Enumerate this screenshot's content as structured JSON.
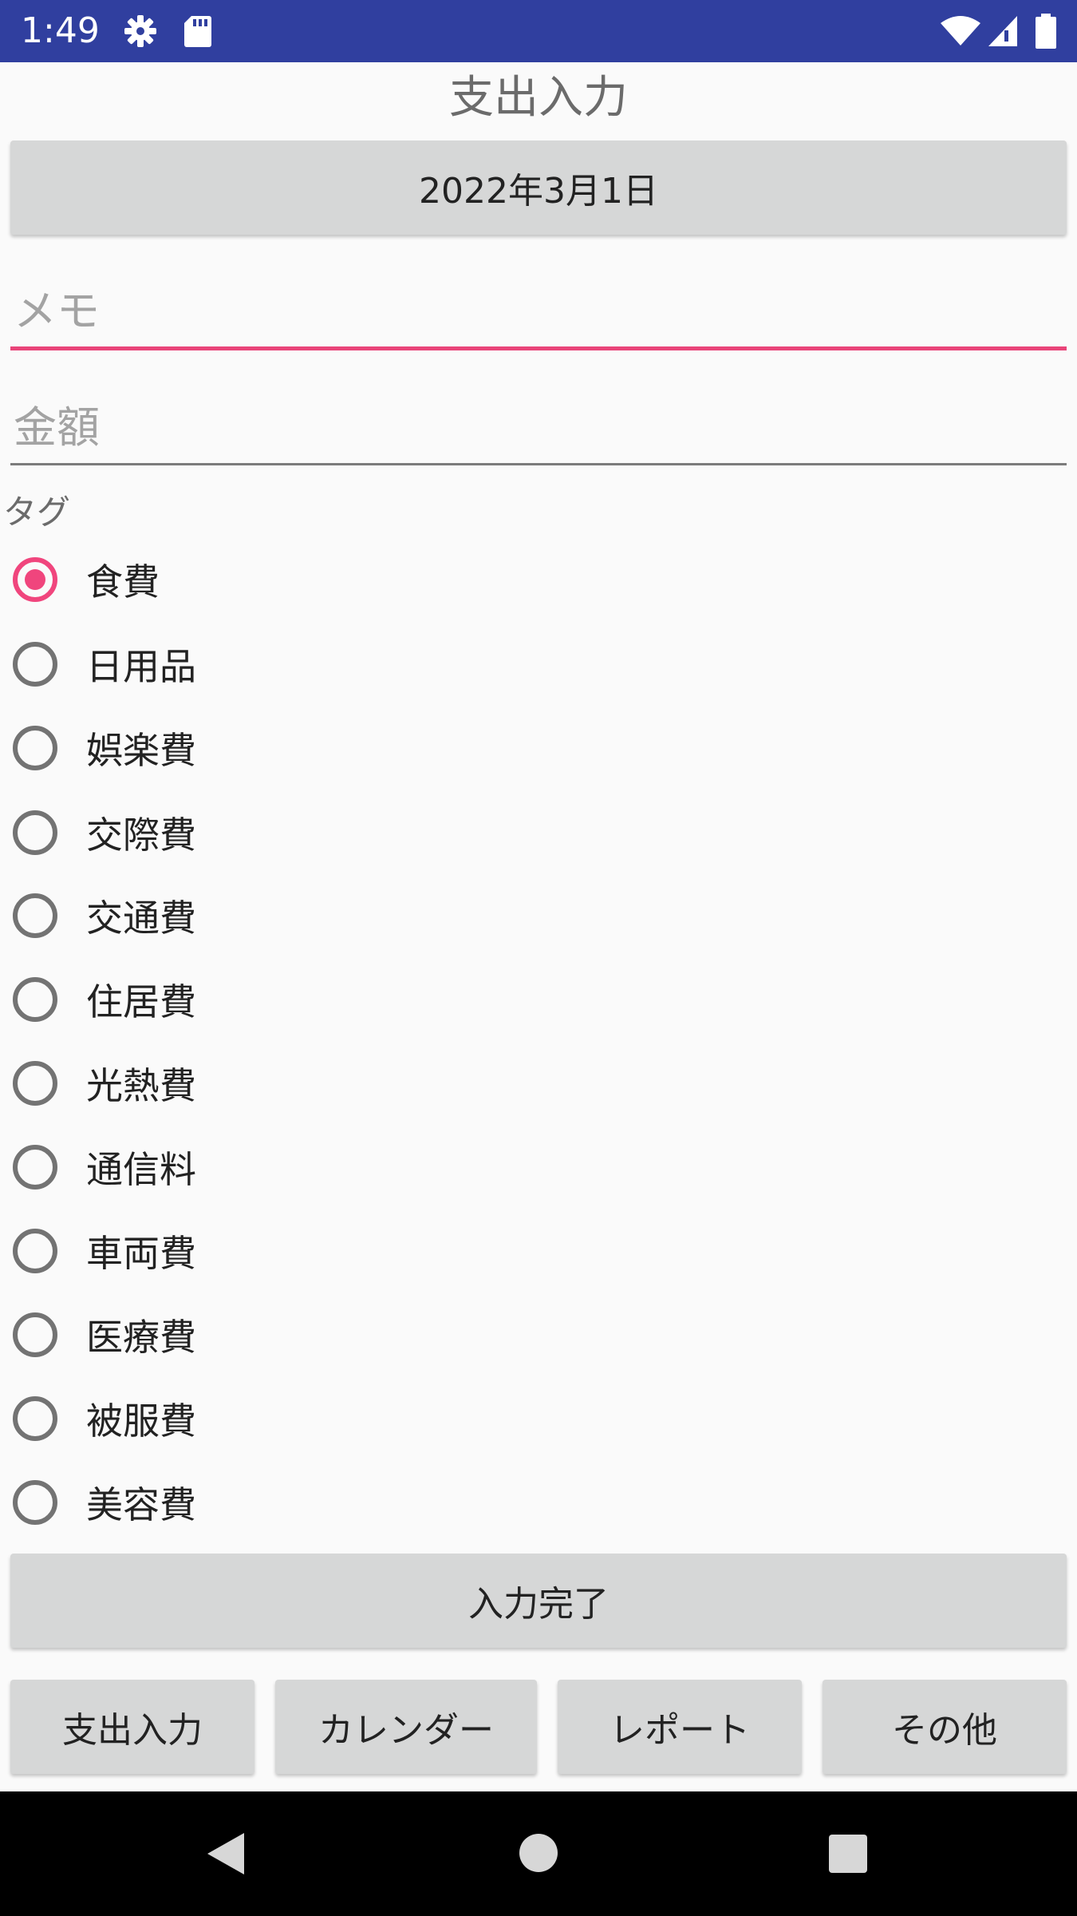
{
  "status_bar": {
    "time": "1:49",
    "color": "#303f9f",
    "icons": [
      "gear-icon",
      "sd-card-icon",
      "wifi-icon",
      "signal-icon",
      "battery-icon"
    ]
  },
  "screen": {
    "title": "支出入力",
    "date_button": "2022年3月1日",
    "memo_placeholder": "メモ",
    "memo_value": "",
    "amount_placeholder": "金額",
    "amount_value": "",
    "tag_label": "タグ",
    "selected_tag": "食費",
    "tags": [
      {
        "label": "食費",
        "checked": true
      },
      {
        "label": "日用品",
        "checked": false
      },
      {
        "label": "娯楽費",
        "checked": false
      },
      {
        "label": "交際費",
        "checked": false
      },
      {
        "label": "交通費",
        "checked": false
      },
      {
        "label": "住居費",
        "checked": false
      },
      {
        "label": "光熱費",
        "checked": false
      },
      {
        "label": "通信料",
        "checked": false
      },
      {
        "label": "車両費",
        "checked": false
      },
      {
        "label": "医療費",
        "checked": false
      },
      {
        "label": "被服費",
        "checked": false
      },
      {
        "label": "美容費",
        "checked": false
      }
    ],
    "submit_button": "入力完了"
  },
  "bottom_tabs": [
    "支出入力",
    "カレンダー",
    "レポート",
    "その他"
  ],
  "colors": {
    "accent": "#f0457d",
    "button_gray": "#d6d7d7",
    "nav_bar": "#000000"
  },
  "nav_bar": {
    "icons": [
      "back-icon",
      "home-icon",
      "recents-icon"
    ]
  }
}
